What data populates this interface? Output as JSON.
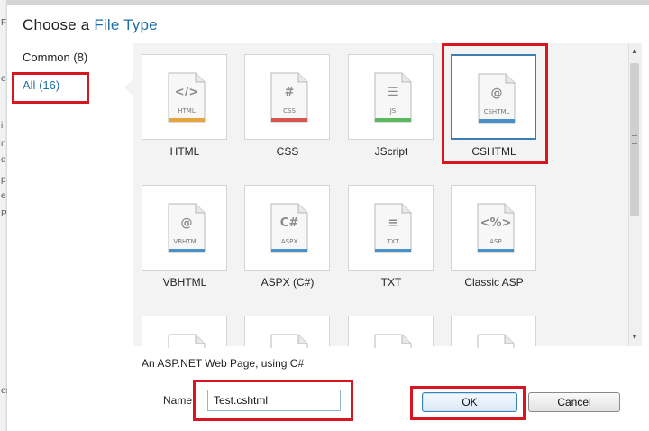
{
  "dialog": {
    "title_prefix": "Choose a",
    "title_accent": "File Type",
    "description": "An ASP.NET Web Page, using C#"
  },
  "categories": [
    {
      "label": "Common",
      "count": "(8)"
    },
    {
      "label": "All",
      "count": "(16)"
    }
  ],
  "file_types": [
    {
      "label": "HTML",
      "glyph": "</>",
      "doc_label": "HTML",
      "accent": "#e8a33c"
    },
    {
      "label": "CSS",
      "glyph": "#",
      "doc_label": "CSS",
      "accent": "#d9534f"
    },
    {
      "label": "JScript",
      "glyph": "☰",
      "doc_label": "JS",
      "accent": "#5cb85c"
    },
    {
      "label": "CSHTML",
      "glyph": "@",
      "doc_label": "CSHTML",
      "accent": "#4a90c8",
      "selected": true
    },
    {
      "label": "VBHTML",
      "glyph": "@",
      "doc_label": "VBHTML",
      "accent": "#4a90c8"
    },
    {
      "label": "ASPX (C#)",
      "glyph": "C#",
      "doc_label": "ASPX",
      "accent": "#4a90c8"
    },
    {
      "label": "TXT",
      "glyph": "≡",
      "doc_label": "TXT",
      "accent": "#4a90c8"
    },
    {
      "label": "Classic ASP",
      "glyph": "<%>",
      "doc_label": "ASP",
      "accent": "#4a90c8"
    }
  ],
  "name_field": {
    "label": "Name",
    "value": "Test.cshtml"
  },
  "buttons": {
    "ok": "OK",
    "cancel": "Cancel"
  },
  "background_chars": [
    "F",
    "e",
    "i",
    "n",
    "d",
    "p",
    "e",
    "P",
    "es"
  ]
}
